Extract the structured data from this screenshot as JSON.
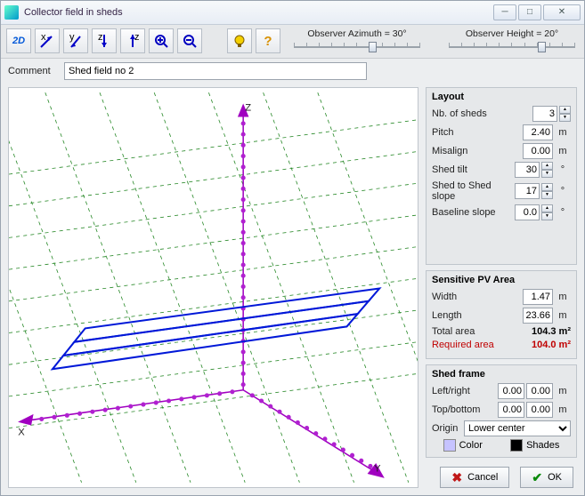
{
  "window": {
    "title": "Collector field in sheds"
  },
  "observer": {
    "azimuth_label": "Observer Azimuth =   30°",
    "height_label": "Observer Height =   20°"
  },
  "comment": {
    "label": "Comment",
    "value": "Shed field no 2"
  },
  "axes": {
    "x": "X",
    "y": "Y",
    "z": "Z"
  },
  "layout": {
    "title": "Layout",
    "nb_sheds_label": "Nb. of sheds",
    "nb_sheds": "3",
    "pitch_label": "Pitch",
    "pitch": "2.40",
    "pitch_unit": "m",
    "misalign_label": "Misalign",
    "misalign": "0.00",
    "misalign_unit": "m",
    "tilt_label": "Shed tilt",
    "tilt": "30",
    "tilt_unit": "°",
    "slope_label": "Shed to Shed slope",
    "slope": "17",
    "slope_unit": "°",
    "baseline_label": "Baseline slope",
    "baseline": "0.0",
    "baseline_unit": "°"
  },
  "pvarea": {
    "title": "Sensitive PV Area",
    "width_label": "Width",
    "width": "1.47",
    "width_unit": "m",
    "length_label": "Length",
    "length": "23.66",
    "length_unit": "m",
    "total_label": "Total area",
    "total": "104.3 m²",
    "required_label": "Required area",
    "required": "104.0 m²"
  },
  "frame": {
    "title": "Shed frame",
    "leftright_label": "Left/right",
    "left": "0.00",
    "right": "0.00",
    "lr_unit": "m",
    "topbottom_label": "Top/bottom",
    "top": "0.00",
    "bottom": "0.00",
    "tb_unit": "m",
    "origin_label": "Origin",
    "origin_selected": "Lower center"
  },
  "swatches": {
    "color_label": "Color",
    "color_hex": "#c6c3ff",
    "shades_label": "Shades",
    "shades_hex": "#000000"
  },
  "buttons": {
    "cancel": "Cancel",
    "ok": "OK"
  },
  "toolbar_icons": [
    "2D",
    "x-",
    "y+",
    "z-",
    "z+",
    "zoom-in-icon",
    "zoom-out-icon",
    "bulb-icon",
    "help-icon"
  ]
}
